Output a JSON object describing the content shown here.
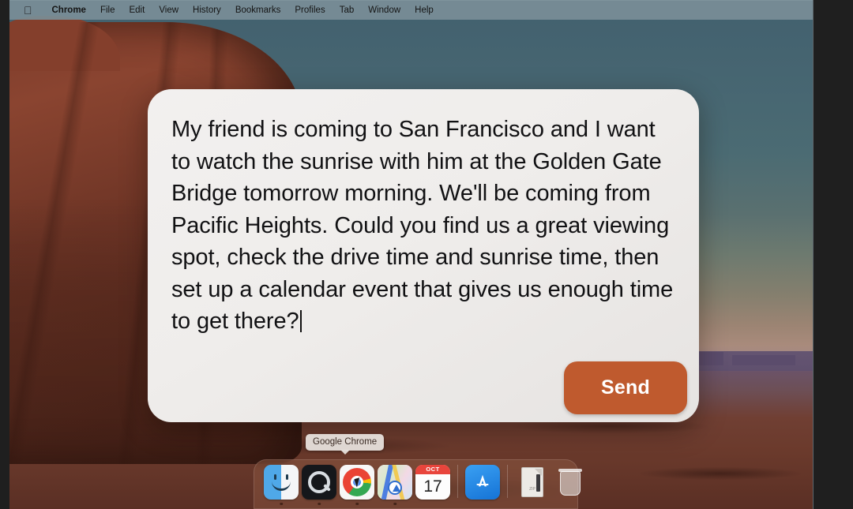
{
  "menubar": {
    "apple_icon": "apple-logo",
    "items": [
      {
        "label": "Chrome",
        "bold": true
      },
      {
        "label": "File",
        "bold": false
      },
      {
        "label": "Edit",
        "bold": false
      },
      {
        "label": "View",
        "bold": false
      },
      {
        "label": "History",
        "bold": false
      },
      {
        "label": "Bookmarks",
        "bold": false
      },
      {
        "label": "Profiles",
        "bold": false
      },
      {
        "label": "Tab",
        "bold": false
      },
      {
        "label": "Window",
        "bold": false
      },
      {
        "label": "Help",
        "bold": false
      }
    ]
  },
  "card": {
    "prompt_text": "My friend is coming to San Francisco and I want to watch the sunrise with him at the Golden Gate Bridge tomorrow morning. We'll be coming from Pacific Heights. Could you find us a great viewing spot, check the drive time and sunrise time, then set up a calendar event that gives us enough time to get there?",
    "send_label": "Send",
    "send_color": "#bf5a2e",
    "background_color": "#efedeb"
  },
  "dock": {
    "tooltip": "Google Chrome",
    "items": [
      {
        "name": "finder",
        "label": "Finder",
        "running": true
      },
      {
        "name": "quicktime",
        "label": "QuickTime Player",
        "running": true
      },
      {
        "name": "chrome",
        "label": "Google Chrome",
        "running": true
      },
      {
        "name": "maps",
        "label": "Maps",
        "running": true
      },
      {
        "name": "calendar",
        "label": "Calendar",
        "running": false,
        "month": "OCT",
        "day": "17"
      },
      {
        "name": "app-store",
        "label": "App Store",
        "running": false
      },
      {
        "name": "document-file",
        "label": "Document",
        "running": false,
        "file_label": "ZIP"
      },
      {
        "name": "trash",
        "label": "Trash",
        "running": false
      }
    ]
  },
  "wallpaper": {
    "name": "Monument Valley desert at dusk",
    "sky_color": "#4b6b73",
    "rock_color": "#7b3b2b"
  }
}
